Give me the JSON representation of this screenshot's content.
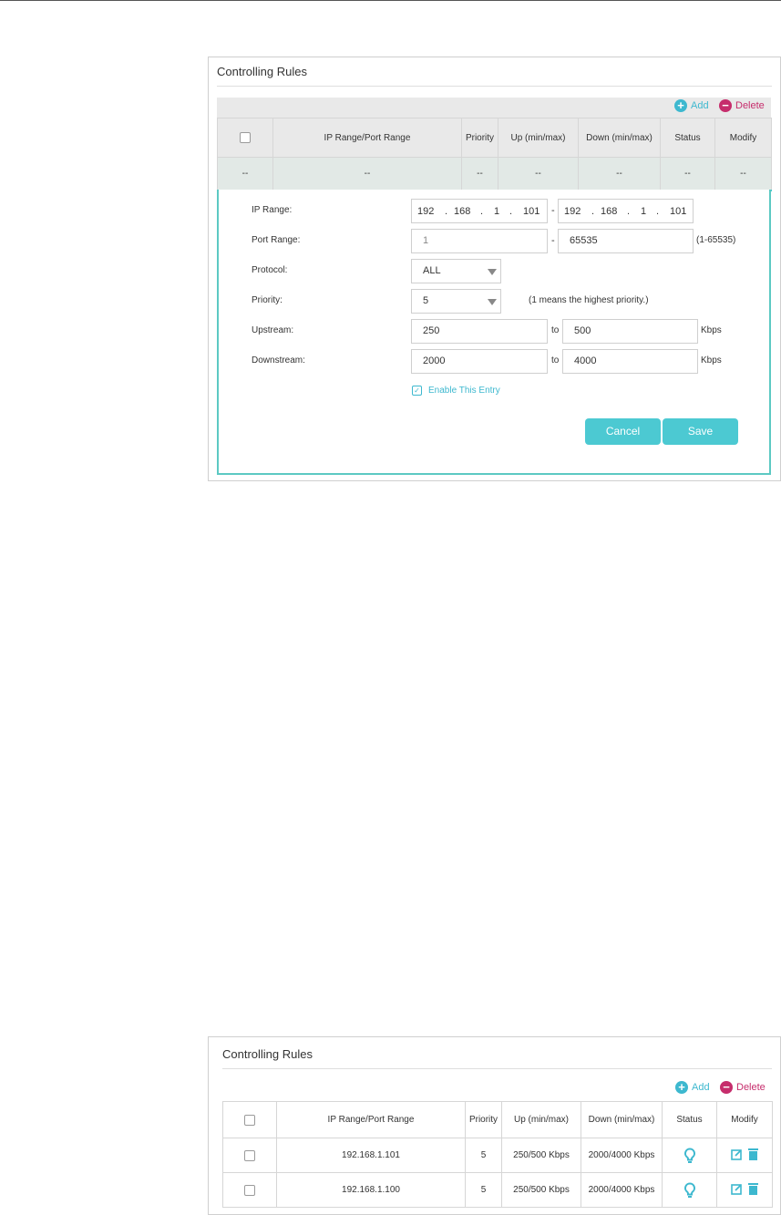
{
  "panel1": {
    "title": "Controlling Rules",
    "add_label": "Add",
    "delete_label": "Delete",
    "columns": [
      "IP Range/Port Range",
      "Priority",
      "Up (min/max)",
      "Down (min/max)",
      "Status",
      "Modify"
    ],
    "placeholder_row": [
      "--",
      "--",
      "--",
      "--",
      "--",
      "--",
      "--"
    ],
    "form": {
      "ip_range_label": "IP Range:",
      "ip_start": [
        "192",
        "168",
        "1",
        "101"
      ],
      "ip_end": [
        "192",
        "168",
        "1",
        "101"
      ],
      "range_sep": "-",
      "dot": ".",
      "port_range_label": "Port Range:",
      "port_start": "1",
      "port_end": "65535",
      "port_hint": "(1-65535)",
      "protocol_label": "Protocol:",
      "protocol_value": "ALL",
      "priority_label": "Priority:",
      "priority_value": "5",
      "priority_hint": "(1 means the highest priority.)",
      "upstream_label": "Upstream:",
      "upstream_min": "250",
      "upstream_max": "500",
      "downstream_label": "Downstream:",
      "downstream_min": "2000",
      "downstream_max": "4000",
      "to_label": "to",
      "unit": "Kbps",
      "enable_label": "Enable This Entry",
      "cancel_label": "Cancel",
      "save_label": "Save"
    }
  },
  "panel2": {
    "title": "Controlling Rules",
    "add_label": "Add",
    "delete_label": "Delete",
    "columns": [
      "IP Range/Port Range",
      "Priority",
      "Up (min/max)",
      "Down (min/max)",
      "Status",
      "Modify"
    ],
    "rows": [
      {
        "ip": "192.168.1.101",
        "priority": "5",
        "up": "250/500 Kbps",
        "down": "2000/4000 Kbps"
      },
      {
        "ip": "192.168.1.100",
        "priority": "5",
        "up": "250/500 Kbps",
        "down": "2000/4000 Kbps"
      }
    ]
  },
  "colors": {
    "accent": "#4cc9d2",
    "add": "#3db8cf",
    "delete": "#c62d6c"
  },
  "icons": [
    "plus-circle-icon",
    "minus-circle-icon",
    "lightbulb-icon",
    "edit-icon",
    "trash-icon",
    "checkbox-icon"
  ]
}
